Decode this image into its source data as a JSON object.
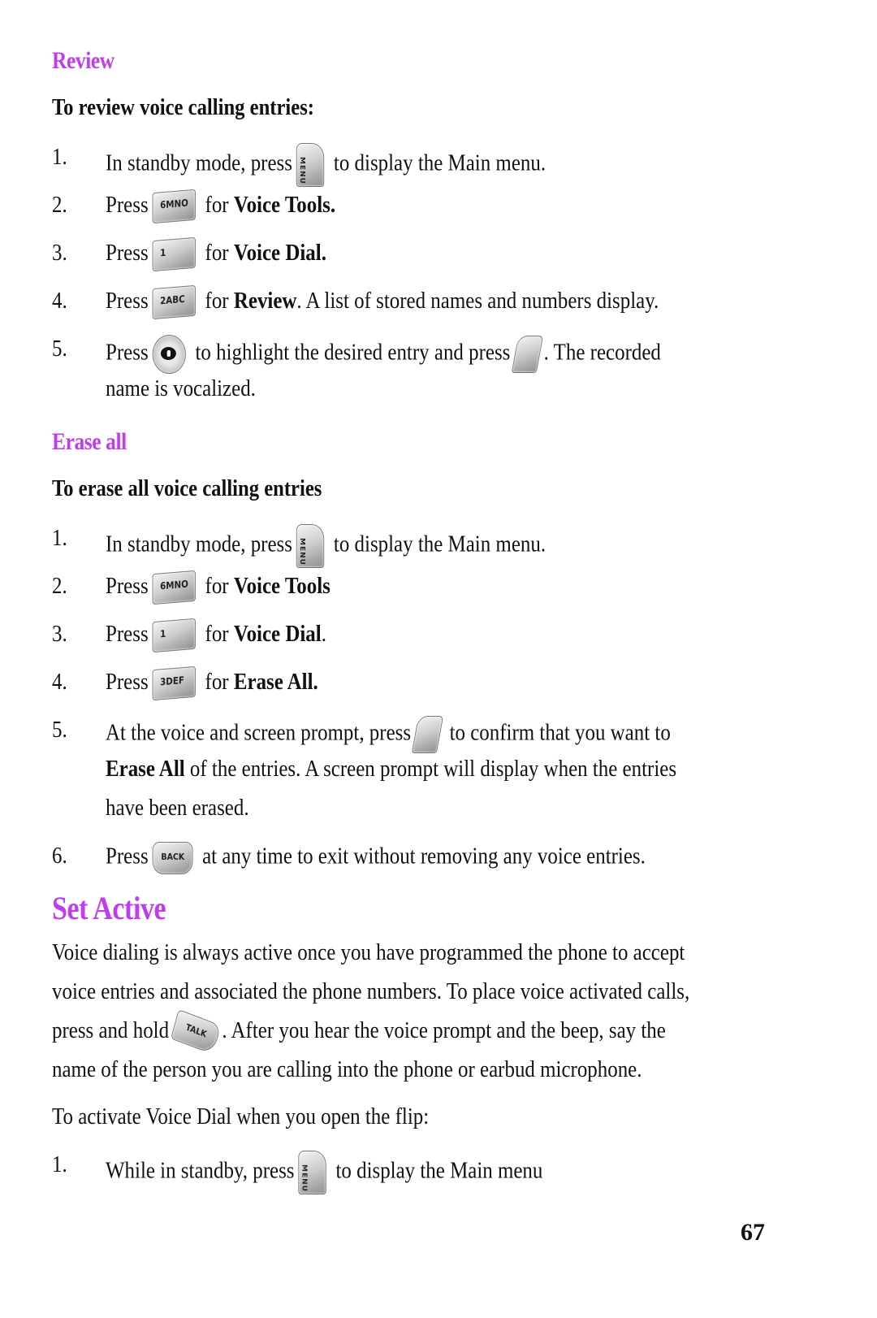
{
  "review": {
    "heading": "Review",
    "subheading": "To review voice calling entries:",
    "steps": [
      {
        "num": "1.",
        "pre": "In standby mode, press",
        "key": "MENU",
        "post": "to display the Main menu."
      },
      {
        "num": "2.",
        "pre": "Press",
        "key": "6MNO",
        "mid": "for ",
        "bold": "Voice Tools.",
        "post": ""
      },
      {
        "num": "3.",
        "pre": "Press",
        "key": "1",
        "mid": "for ",
        "bold": "Voice Dial.",
        "post": ""
      },
      {
        "num": "4.",
        "pre": "Press",
        "key": "2ABC",
        "mid": "for ",
        "bold": "Review",
        "post": ". A list of stored names and numbers display."
      },
      {
        "num": "5.",
        "pre": "Press",
        "key": "navigation key",
        "mid": "to highlight the desired entry and press",
        "key2": "OK",
        "post": ". The recorded",
        "cont": "name is vocalized."
      }
    ]
  },
  "erase_all": {
    "heading": "Erase all",
    "subheading": "To erase all voice calling entries",
    "steps": [
      {
        "num": "1.",
        "pre": "In standby mode, press",
        "key": "MENU",
        "post": "to display the Main menu."
      },
      {
        "num": "2.",
        "pre": "Press",
        "key": "6MNO",
        "mid": "for ",
        "bold": "Voice Tools",
        "post": ""
      },
      {
        "num": "3.",
        "pre": "Press",
        "key": "1",
        "mid": "for ",
        "bold": "Voice Dial",
        "post": "."
      },
      {
        "num": "4.",
        "pre": "Press",
        "key": "3DEF",
        "mid": "for ",
        "bold": "Erase All.",
        "post": ""
      },
      {
        "num": "5.",
        "pre": "At the voice and screen prompt, press",
        "key": "OK",
        "post": "to confirm that you want to",
        "cont_bold": "Erase All",
        "cont": " of the entries. A screen prompt will display when the entries",
        "cont2": "have been erased."
      },
      {
        "num": "6.",
        "pre": "Press",
        "key": "BACK",
        "post": "at any time to exit without removing any voice entries."
      }
    ]
  },
  "set_active": {
    "heading": "Set Active",
    "para_lines": [
      "Voice dialing is always active once you have programmed the phone to accept",
      "voice entries and associated the phone numbers. To place voice activated calls,"
    ],
    "para_line3_pre": "press and hold",
    "para_line3_key": "TALK",
    "para_line3_post": ". After you hear the voice prompt and the beep, say the",
    "para_line4": "name of the person you are calling into the phone or earbud microphone.",
    "intro": "To activate Voice Dial when you open the flip:",
    "steps": [
      {
        "num": "1.",
        "pre": "While in standby, press",
        "key": "MENU",
        "post": "to display the Main menu"
      }
    ]
  },
  "page_number": "67",
  "colors": {
    "heading": "#c13cf0",
    "text": "#111111"
  }
}
